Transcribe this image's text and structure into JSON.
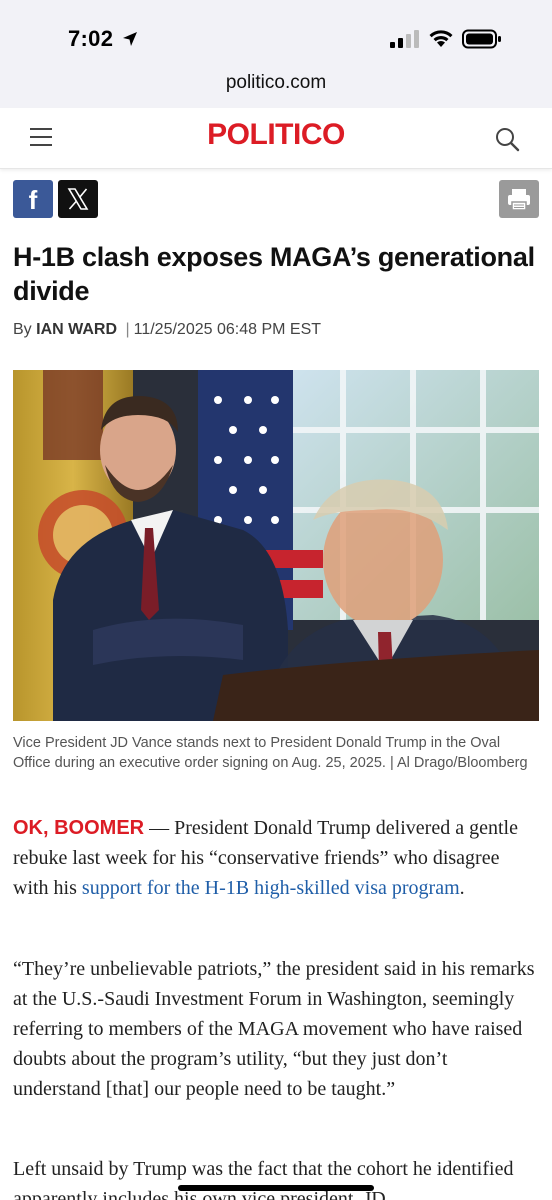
{
  "status": {
    "time": "7:02"
  },
  "browser": {
    "url": "politico.com"
  },
  "header": {
    "logo": "POLITICO"
  },
  "share": {
    "facebook": "f"
  },
  "article": {
    "headline": "H-1B clash exposes MAGA’s generational divide",
    "byline_prefix": "By",
    "author": "IAN WARD",
    "separator": "|",
    "date": "11/25/2025 06:48 PM EST",
    "caption": "Vice President JD Vance stands next to President Donald Trump in the Oval Office during an executive order signing on Aug. 25, 2025. | Al Drago/Bloomberg",
    "p1_kicker": "OK, BOOMER",
    "p1_text": " — President Donald Trump delivered a gentle rebuke last week for his “conservative friends” who disagree with his ",
    "p1_link": "support for the H-1B high-skilled visa program",
    "p1_end": ".",
    "p2": "“They’re unbelievable patriots,” the president said in his remarks at the U.S.-Saudi Investment Forum in Washington, seemingly referring to members of the MAGA movement who have raised doubts about the program’s utility, “but they just don’t understand [that] our people need to be taught.”",
    "p3": "Left unsaid by Trump was the fact that the cohort he identified apparently includes his own vice president, JD"
  },
  "colors": {
    "brand": "#dc1c25",
    "link": "#1f5ea8",
    "facebook": "#3b5998"
  }
}
